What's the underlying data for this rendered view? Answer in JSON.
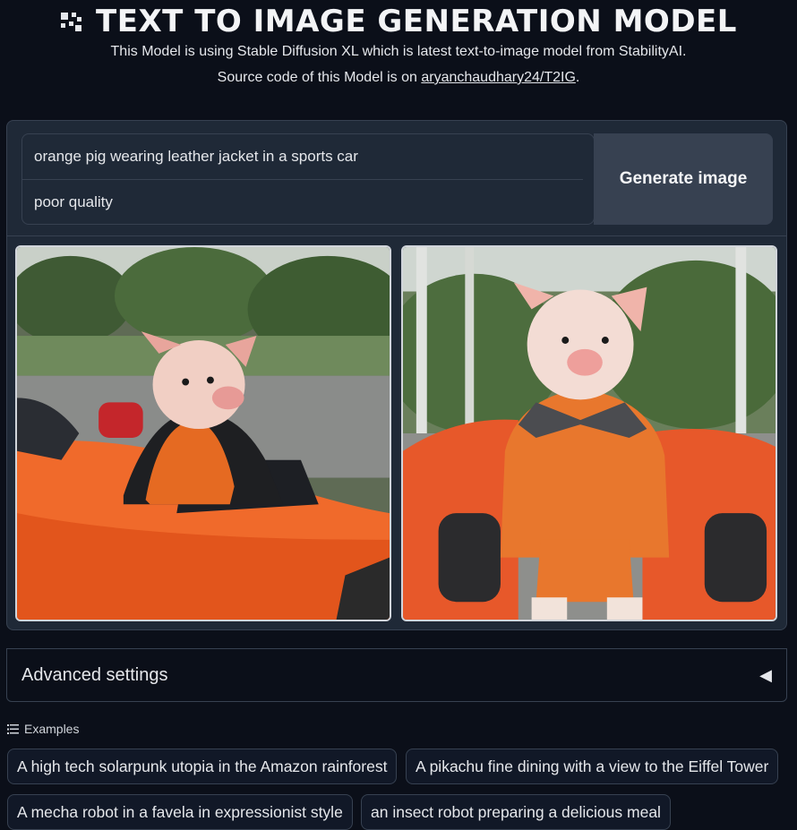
{
  "header": {
    "logo_icon": "qr-grid-icon",
    "title": "TEXT TO IMAGE GENERATION MODEL",
    "subtitle": "This Model is using Stable Diffusion XL which is latest text-to-image model from StabilityAI.",
    "source_prefix": "Source code of this Model is on ",
    "source_link": "aryanchaudhary24/T2IG",
    "source_suffix": "."
  },
  "form": {
    "prompt": "orange pig wearing leather jacket in a sports car",
    "negative_prompt": "poor quality",
    "generate_label": "Generate image"
  },
  "gallery": {
    "images": [
      {
        "description_icon": "pig-in-car-image"
      },
      {
        "description_icon": "pig-standing-image"
      }
    ]
  },
  "advanced": {
    "label": "Advanced settings",
    "arrow_icon": "triangle-left-icon"
  },
  "examples": {
    "label": "Examples",
    "icon": "list-icon",
    "items": [
      "A high tech solarpunk utopia in the Amazon rainforest",
      "A pikachu fine dining with a view to the Eiffel Tower",
      "A mecha robot in a favela in expressionist style",
      "an insect robot preparing a delicious meal"
    ]
  },
  "colors": {
    "background": "#0b0f19",
    "panel": "#1f2937",
    "border": "#374151",
    "button": "#374151"
  }
}
